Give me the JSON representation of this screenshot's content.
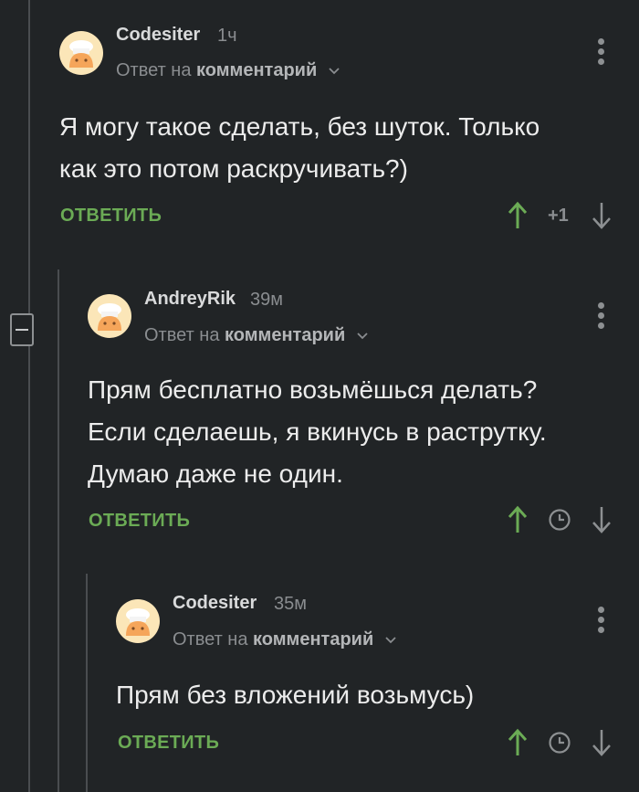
{
  "comments": [
    {
      "author": "Codesiter",
      "time": "1ч",
      "reply_prefix": "Ответ на",
      "reply_target": "комментарий",
      "text_lines": [
        "Я могу такое сделать, без шуток. Только",
        "как это потом раскручивать?)"
      ],
      "reply_label": "ОТВЕТИТЬ",
      "score": "+1"
    },
    {
      "author": "AndreyRik",
      "time": "39м",
      "reply_prefix": "Ответ на",
      "reply_target": "комментарий",
      "text_lines": [
        "Прям бесплатно возьмёшься делать?",
        "Если сделаешь, я вкинусь в раструтку.",
        "Думаю даже не один."
      ],
      "reply_label": "ОТВЕТИТЬ"
    },
    {
      "author": "Codesiter",
      "time": "35м",
      "reply_prefix": "Ответ на",
      "reply_target": "комментарий",
      "text_lines": [
        "Прям без вложений возьмусь)"
      ],
      "reply_label": "ОТВЕТИТЬ"
    }
  ],
  "colors": {
    "background": "#212426",
    "accent_green": "#6bab55",
    "muted": "#8a8d90"
  },
  "icons": [
    "avatar-chef-icon",
    "chevron-down-icon",
    "kebab-menu-icon",
    "arrow-up-icon",
    "arrow-down-icon",
    "clock-icon",
    "collapse-minus-icon"
  ]
}
